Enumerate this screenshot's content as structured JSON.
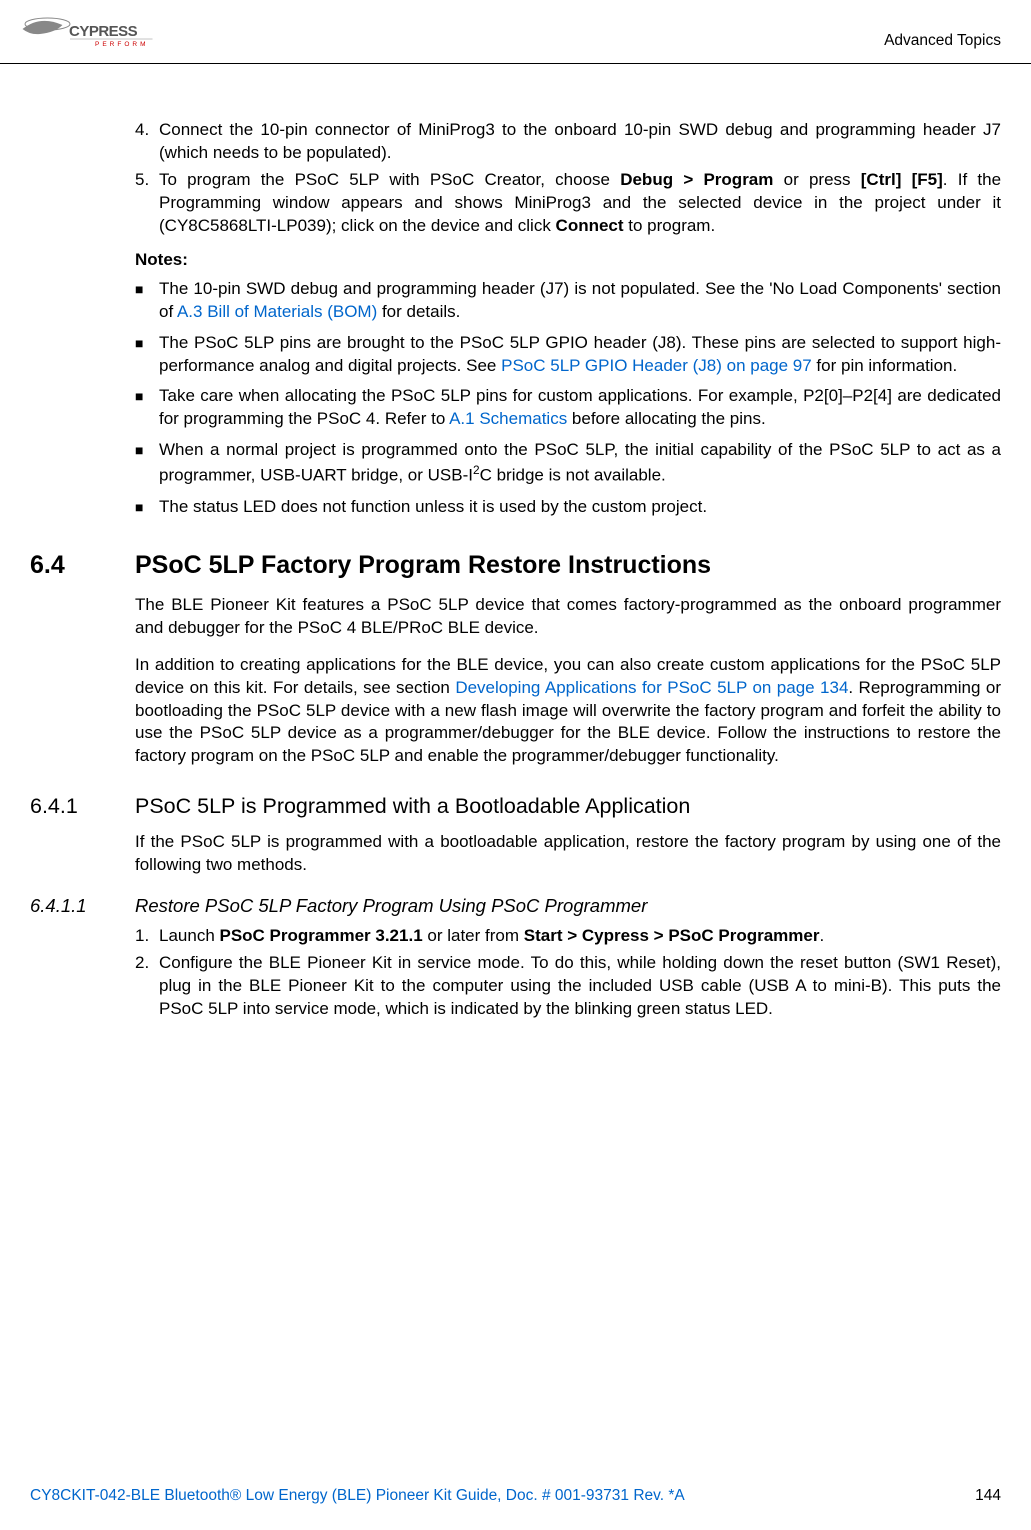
{
  "header": {
    "title": "Advanced Topics"
  },
  "steps": {
    "s4": {
      "num": "4.",
      "text": "Connect the 10-pin connector of MiniProg3 to the onboard 10-pin SWD debug and programming header J7 (which needs to be populated)."
    },
    "s5": {
      "num": "5.",
      "t1": "To program the PSoC 5LP with PSoC Creator, choose ",
      "b1": "Debug > Program",
      "t2": " or press ",
      "b2": "[Ctrl] [F5]",
      "t3": ". If the Programming window appears and shows MiniProg3 and the selected device in the project under it (CY8C5868LTI-LP039); click on the device and click ",
      "b3": "Connect",
      "t4": " to program."
    }
  },
  "notes_label": "Notes:",
  "notes": {
    "n1": {
      "t1": "The 10-pin SWD debug and programming header (J7) is not populated. See the 'No Load Components' section of ",
      "link": "A.3 Bill of Materials (BOM)",
      "t2": " for details."
    },
    "n2": {
      "t1": "The PSoC 5LP pins are brought to the PSoC 5LP GPIO header (J8). These pins are selected to support high-performance analog and digital projects. See ",
      "link": "PSoC 5LP GPIO Header (J8) on page 97",
      "t2": " for pin information."
    },
    "n3": {
      "t1": "Take care when allocating the PSoC 5LP pins for custom applications. For example, P2[0]–P2[4] are dedicated for programming the PSoC 4. Refer to ",
      "link": "A.1 Schematics",
      "t2": " before allocating the pins."
    },
    "n4": {
      "t1": "When a normal project is programmed onto the PSoC 5LP, the initial capability of the PSoC 5LP to act as a programmer, USB-UART bridge, or USB-I",
      "sup": "2",
      "t2": "C bridge is not available."
    },
    "n5": "The status LED does not function unless it is used by the custom project."
  },
  "sec64": {
    "num": "6.4",
    "title": "PSoC 5LP Factory Program Restore Instructions",
    "p1": "The BLE Pioneer Kit features a PSoC 5LP device that comes factory-programmed as the onboard programmer and debugger for the PSoC 4 BLE/PRoC BLE device.",
    "p2": {
      "t1": "In addition to creating applications for the BLE device, you can also create custom applications for the PSoC 5LP device on this kit. For details, see section ",
      "link": "Developing Applications for PSoC 5LP on page 134",
      "t2": ". Reprogramming or bootloading the PSoC 5LP device with a new flash image will overwrite the factory program and forfeit the ability to use the PSoC 5LP device as a programmer/debugger for the BLE device. Follow the instructions to restore the factory program on the PSoC 5LP and enable the programmer/debugger functionality."
    }
  },
  "sec641": {
    "num": "6.4.1",
    "title": "PSoC 5LP is Programmed with a Bootloadable Application",
    "p1": "If the PSoC 5LP is programmed with a bootloadable application, restore the factory program by using one of the following two methods."
  },
  "sec6411": {
    "num": "6.4.1.1",
    "title": "Restore PSoC 5LP Factory Program Using PSoC Programmer",
    "s1": {
      "num": "1.",
      "t1": "Launch ",
      "b1": "PSoC Programmer 3.21.1",
      "t2": " or later from ",
      "b2": "Start > Cypress > PSoC Programmer",
      "t3": "."
    },
    "s2": {
      "num": "2.",
      "text": "Configure the BLE Pioneer Kit in service mode. To do this, while holding down the reset button (SW1 Reset), plug in the BLE Pioneer Kit to the computer using the included USB cable (USB A to mini-B). This puts the PSoC 5LP into service mode, which is indicated by the blinking green status LED."
    }
  },
  "footer": {
    "doc": "CY8CKIT-042-BLE Bluetooth® Low Energy (BLE) Pioneer Kit Guide, Doc. # 001-93731 Rev. *A",
    "page": "144"
  }
}
